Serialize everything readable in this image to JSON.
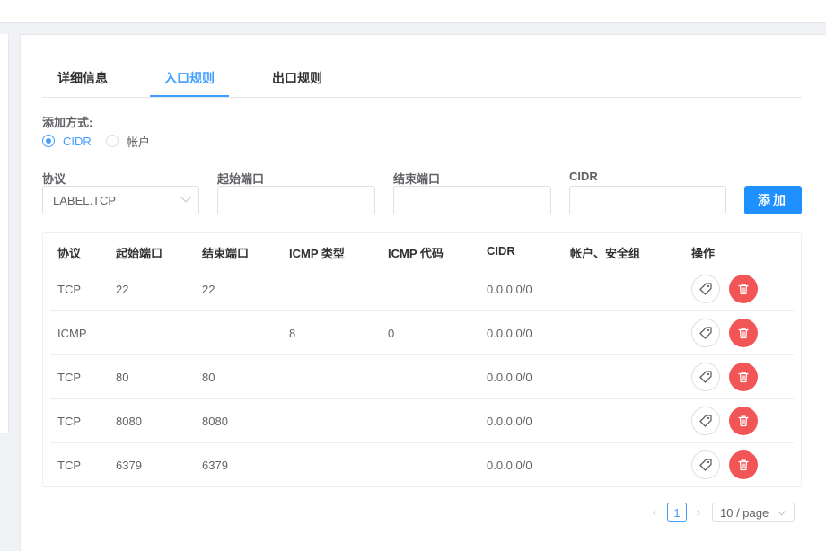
{
  "tabs": [
    {
      "label": "详细信息",
      "active": false
    },
    {
      "label": "入口规则",
      "active": true
    },
    {
      "label": "出口规则",
      "active": false
    }
  ],
  "form": {
    "method_label": "添加方式:",
    "methods": [
      {
        "label": "CIDR",
        "checked": true
      },
      {
        "label": "帐户",
        "checked": false
      }
    ],
    "protocol_label": "协议",
    "protocol_value": "LABEL.TCP",
    "start_port_label": "起始端口",
    "end_port_label": "结束端口",
    "cidr_label": "CIDR",
    "add_label": "添加"
  },
  "table": {
    "headers": [
      "协议",
      "起始端口",
      "结束端口",
      "ICMP 类型",
      "ICMP 代码",
      "CIDR",
      "帐户、安全组",
      "操作"
    ],
    "rows": [
      {
        "protocol": "TCP",
        "start_port": "22",
        "end_port": "22",
        "icmp_type": "",
        "icmp_code": "",
        "cidr": "0.0.0.0/0",
        "account": ""
      },
      {
        "protocol": "ICMP",
        "start_port": "",
        "end_port": "",
        "icmp_type": "8",
        "icmp_code": "0",
        "cidr": "0.0.0.0/0",
        "account": ""
      },
      {
        "protocol": "TCP",
        "start_port": "80",
        "end_port": "80",
        "icmp_type": "",
        "icmp_code": "",
        "cidr": "0.0.0.0/0",
        "account": ""
      },
      {
        "protocol": "TCP",
        "start_port": "8080",
        "end_port": "8080",
        "icmp_type": "",
        "icmp_code": "",
        "cidr": "0.0.0.0/0",
        "account": ""
      },
      {
        "protocol": "TCP",
        "start_port": "6379",
        "end_port": "6379",
        "icmp_type": "",
        "icmp_code": "",
        "cidr": "0.0.0.0/0",
        "account": ""
      }
    ],
    "action_icons": [
      "tag-icon",
      "trash-icon"
    ]
  },
  "pagination": {
    "current_page": "1",
    "page_size": "10 / page",
    "prev_glyph": "‹",
    "next_glyph": "›"
  },
  "colors": {
    "accent": "#409eff",
    "add_button": "#1e90ff",
    "danger": "#f25555"
  }
}
